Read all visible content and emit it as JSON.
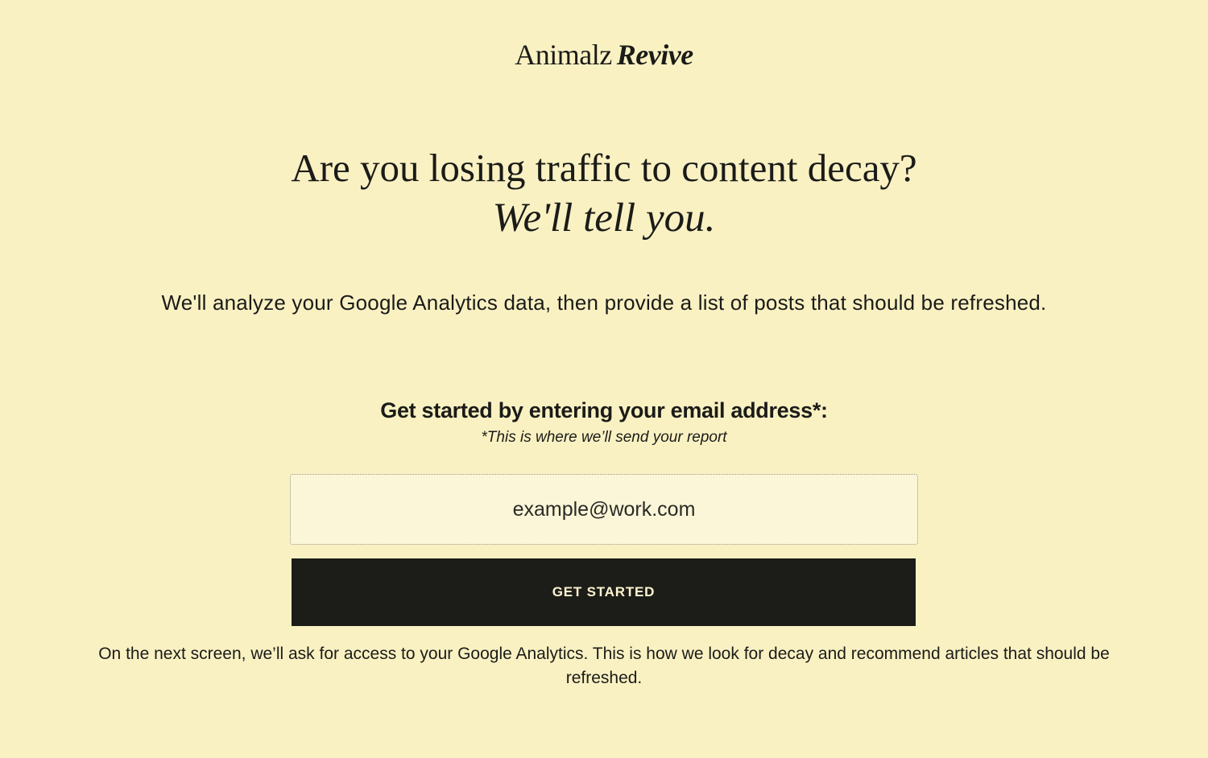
{
  "brand": {
    "name_part1": "Animalz",
    "name_part2": "Revive"
  },
  "hero": {
    "headline_line1": "Are you losing traffic to content decay?",
    "headline_line2": "We'll tell you.",
    "subtitle": "We'll analyze your Google Analytics data, then provide a list of posts that should be refreshed."
  },
  "signup": {
    "title": "Get started by entering your email address*:",
    "note": "*This is where we’ll send your report",
    "email_placeholder": "example@work.com",
    "button_label": "GET STARTED",
    "footnote": "On the next screen, we’ll ask for access to your Google Analytics. This is how we look for decay and recommend articles that should be refreshed."
  },
  "colors": {
    "background": "#faf1c3",
    "text": "#1b1b18",
    "button_bg": "#1c1c18",
    "button_text": "#fdf5cf"
  }
}
